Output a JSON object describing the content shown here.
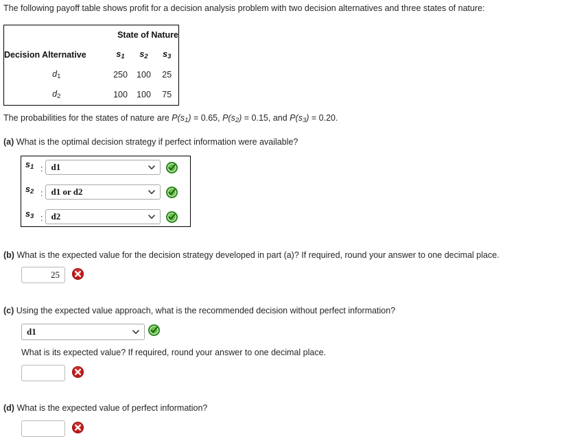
{
  "intro": "The following payoff table shows profit for a decision analysis problem with two decision alternatives and three states of nature:",
  "payoff_table": {
    "group_header": "State of Nature",
    "row_header": "Decision Alternative",
    "state_headers": [
      {
        "base": "s",
        "sub": "1"
      },
      {
        "base": "s",
        "sub": "2"
      },
      {
        "base": "s",
        "sub": "3"
      }
    ],
    "rows": [
      {
        "alternative": {
          "base": "d",
          "sub": "1"
        },
        "values": [
          "250",
          "100",
          "25"
        ]
      },
      {
        "alternative": {
          "base": "d",
          "sub": "2"
        },
        "values": [
          "100",
          "100",
          "75"
        ]
      }
    ]
  },
  "probabilities": {
    "prefix": "The probabilities for the states of nature are ",
    "items": [
      {
        "p": "P",
        "open": "(",
        "base": "s",
        "sub": "1",
        "close": ")",
        "eq": " = ",
        "value": "0.65",
        "tail": ", "
      },
      {
        "p": "P",
        "open": "(",
        "base": "s",
        "sub": "2",
        "close": ")",
        "eq": " = ",
        "value": "0.15",
        "tail": ", and "
      },
      {
        "p": "P",
        "open": "(",
        "base": "s",
        "sub": "3",
        "close": ")",
        "eq": " = ",
        "value": "0.20",
        "tail": "."
      }
    ]
  },
  "questions": {
    "a": {
      "label": "(a)",
      "text": "What is the optimal decision strategy if perfect information were available?",
      "rows": [
        {
          "state_base": "s",
          "state_sub": "1",
          "separator": ":",
          "selected": "d1",
          "status": "correct"
        },
        {
          "state_base": "s",
          "state_sub": "2",
          "separator": ":",
          "selected": "d1 or d2",
          "status": "correct"
        },
        {
          "state_base": "s",
          "state_sub": "3",
          "separator": ":",
          "selected": "d2",
          "status": "correct"
        }
      ]
    },
    "b": {
      "label": "(b)",
      "text": "What is the expected value for the decision strategy developed in part (a)? If required, round your answer to one decimal place.",
      "value": "25",
      "status": "incorrect"
    },
    "c": {
      "label": "(c)",
      "text": "Using the expected value approach, what is the recommended decision without perfect information?",
      "selected": "d1",
      "status": "correct",
      "sub_text": "What is its expected value? If required, round your answer to one decimal place.",
      "sub_value": "",
      "sub_status": "incorrect"
    },
    "d": {
      "label": "(d)",
      "text": "What is the expected value of perfect information?",
      "value": "",
      "status": "incorrect"
    }
  },
  "colors": {
    "correct_green": "#2e8b1f",
    "incorrect_red": "#c01a1a",
    "text": "#252525",
    "border": "#000000"
  },
  "icons": {
    "correct": "check-circle-icon",
    "incorrect": "x-circle-icon",
    "dropdown": "chevron-down-icon"
  }
}
